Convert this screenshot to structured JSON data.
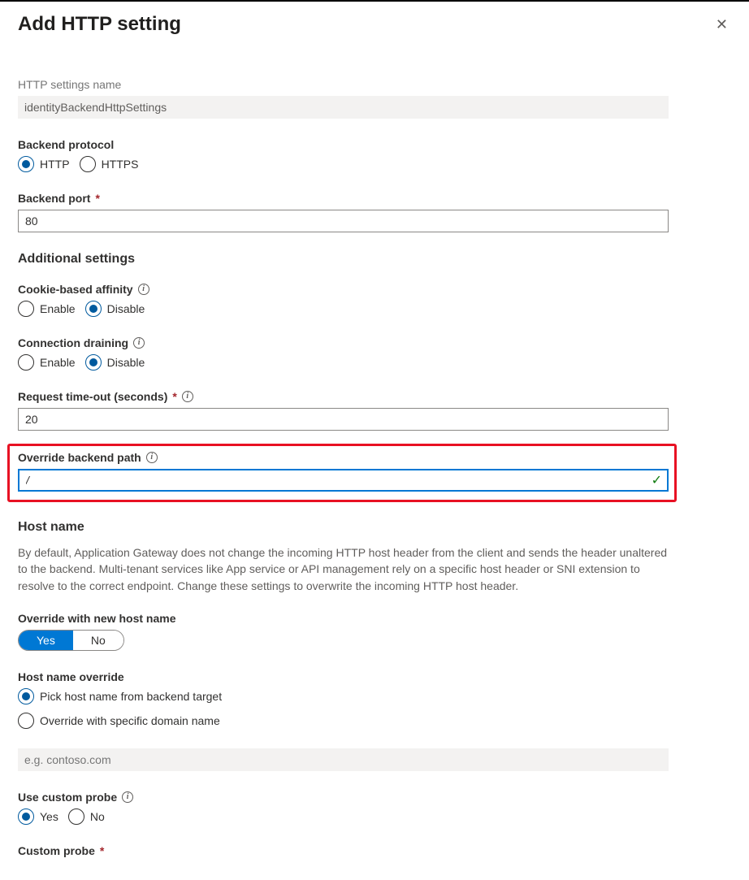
{
  "header": {
    "title": "Add HTTP setting"
  },
  "name": {
    "label": "HTTP settings name",
    "value": "identityBackendHttpSettings"
  },
  "protocol": {
    "label": "Backend protocol",
    "options": {
      "http": "HTTP",
      "https": "HTTPS"
    },
    "selected": "http"
  },
  "port": {
    "label": "Backend port",
    "value": "80"
  },
  "sections": {
    "additional": "Additional settings",
    "hostname": "Host name"
  },
  "affinity": {
    "label": "Cookie-based affinity",
    "options": {
      "enable": "Enable",
      "disable": "Disable"
    },
    "selected": "disable"
  },
  "draining": {
    "label": "Connection draining",
    "options": {
      "enable": "Enable",
      "disable": "Disable"
    },
    "selected": "disable"
  },
  "timeout": {
    "label": "Request time-out (seconds)",
    "value": "20"
  },
  "override_path": {
    "label": "Override backend path",
    "value": "/"
  },
  "hostname_help": "By default, Application Gateway does not change the incoming HTTP host header from the client and sends the header unaltered to the backend. Multi-tenant services like App service or API management rely on a specific host header or SNI extension to resolve to the correct endpoint. Change these settings to overwrite the incoming HTTP host header.",
  "override_host": {
    "label": "Override with new host name",
    "options": {
      "yes": "Yes",
      "no": "No"
    },
    "selected": "yes"
  },
  "hostname_override": {
    "label": "Host name override",
    "options": {
      "pick": "Pick host name from backend target",
      "specific": "Override with specific domain name"
    },
    "selected": "pick"
  },
  "domain": {
    "placeholder": "e.g. contoso.com"
  },
  "custom_probe": {
    "label": "Use custom probe",
    "options": {
      "yes": "Yes",
      "no": "No"
    },
    "selected": "yes"
  },
  "probe_select": {
    "label": "Custom probe"
  }
}
